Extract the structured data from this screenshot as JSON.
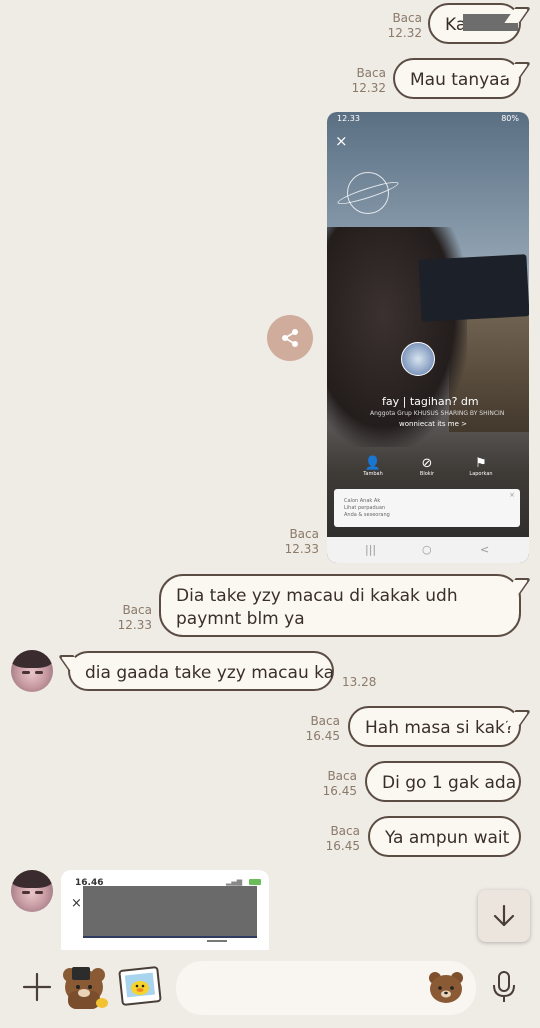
{
  "messages": [
    {
      "id": "m1",
      "status": "Baca",
      "time": "12.32",
      "text": "Ka",
      "redacted": true
    },
    {
      "id": "m2",
      "status": "Baca",
      "time": "12.32",
      "text": "Mau tanyaa"
    },
    {
      "id": "m3",
      "status": "Baca",
      "time": "12.33",
      "type": "screenshot"
    },
    {
      "id": "m4",
      "status": "Baca",
      "time": "12.33",
      "text": "Dia take yzy macau di kakak udh paymnt blm ya"
    },
    {
      "id": "m5",
      "time": "13.28",
      "text": "dia gaada take yzy macau ka",
      "incoming": true
    },
    {
      "id": "m6",
      "status": "Baca",
      "time": "16.45",
      "text": "Hah masa si kak?"
    },
    {
      "id": "m7",
      "status": "Baca",
      "time": "16.45",
      "text": "Di go 1 gak ada"
    },
    {
      "id": "m8",
      "status": "Baca",
      "time": "16.45",
      "text": "Ya ampun wait"
    }
  ],
  "screenshot": {
    "status_time": "12.33",
    "battery": "80%",
    "close": "×",
    "profile_name": "fay | tagihan? dm",
    "profile_sub": "Anggota Grup KHUSUS SHARING BY SHINCIN",
    "profile_handle": "wonniecat its me >",
    "actions": [
      {
        "icon": "👤",
        "label": "Tambah"
      },
      {
        "icon": "⊘",
        "label": "Blokir"
      },
      {
        "icon": "⚑",
        "label": "Laporkan"
      }
    ],
    "card_line1": "Calon Anak Ak",
    "card_line2": "Lihat perpaduan",
    "card_line3": "Anda & seseorang",
    "card_close": "×",
    "nav": [
      "|||",
      "○",
      "<"
    ]
  },
  "image_thumb": {
    "time": "16.46",
    "close": "×"
  },
  "input": {
    "placeholder": ""
  },
  "colors": {
    "background": "#efebe5",
    "bubble": "#fbf8f2",
    "bubble_border": "#5b4d43",
    "share": "#cfac9c"
  },
  "icons": [
    "plus-icon",
    "brown-bear-sticker-icon",
    "sally-photo-icon",
    "bear-emoji-icon",
    "microphone-icon",
    "share-icon",
    "arrow-down-icon"
  ]
}
